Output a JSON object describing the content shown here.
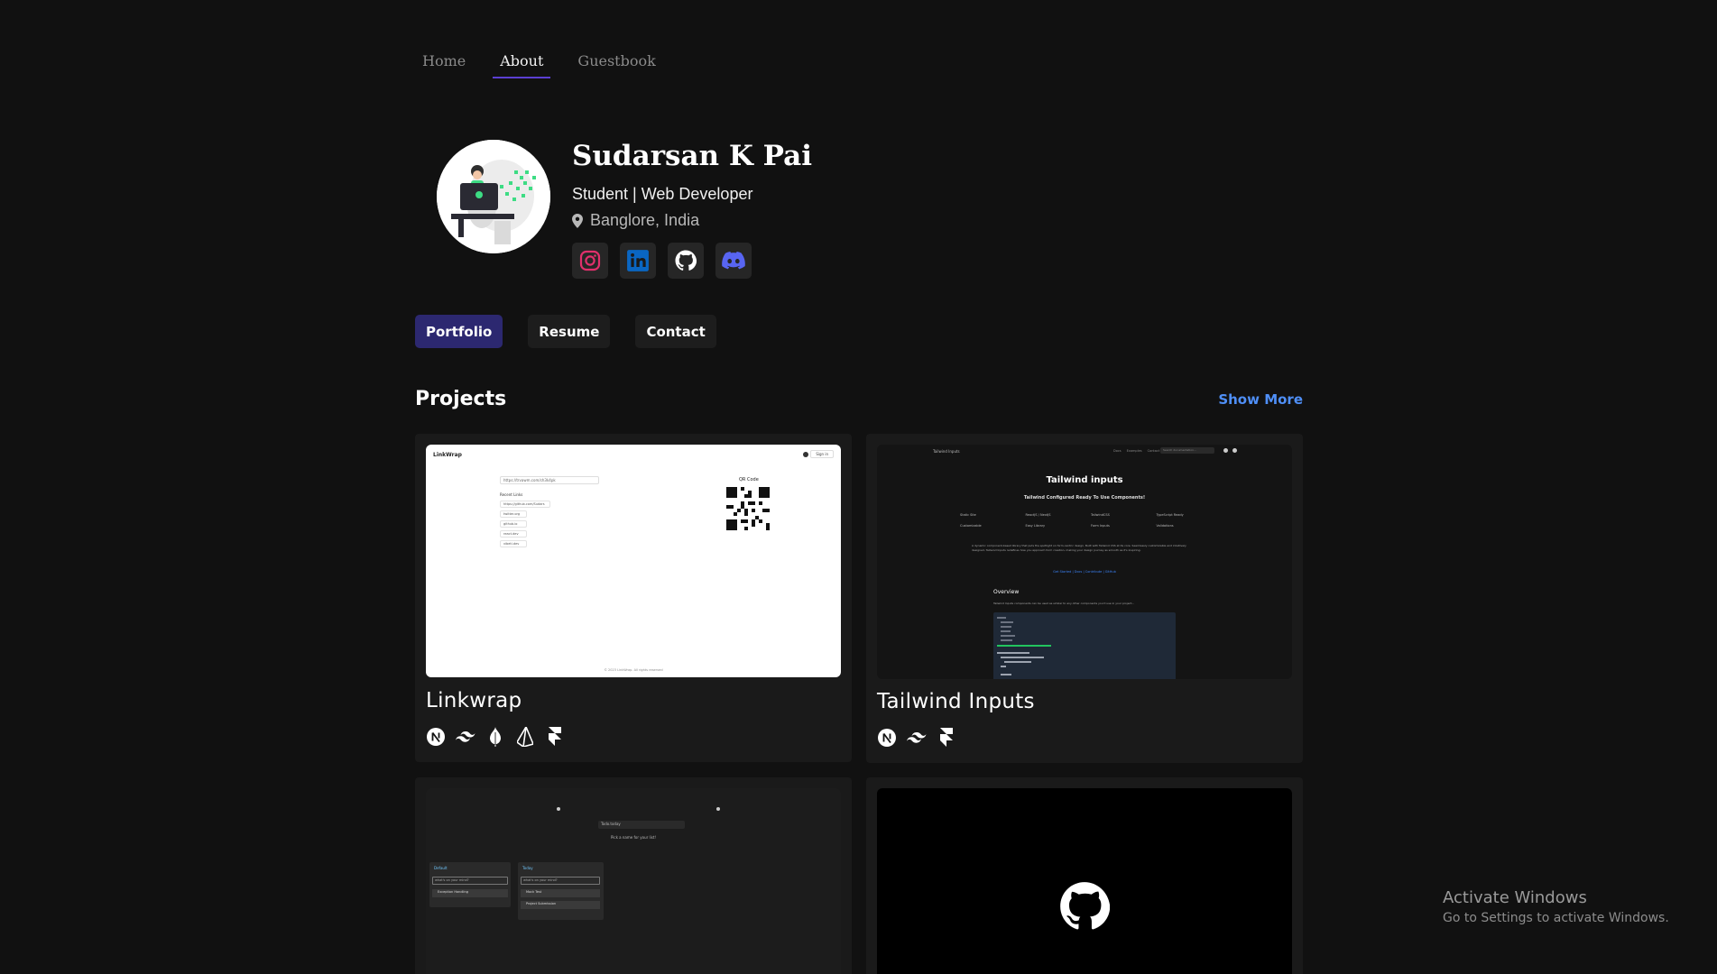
{
  "nav": {
    "items": [
      {
        "label": "Home"
      },
      {
        "label": "About"
      },
      {
        "label": "Guestbook"
      }
    ],
    "active": "About",
    "accent": "#5b3fd3"
  },
  "profile": {
    "name": "Sudarsan K Pai",
    "role": "Student | Web Developer",
    "location": "Banglore, India",
    "socials": [
      {
        "icon": "instagram-icon",
        "color": "#e1306c"
      },
      {
        "icon": "linkedin-icon",
        "color": "#0a66c2"
      },
      {
        "icon": "github-icon",
        "color": "#ffffff"
      },
      {
        "icon": "discord-icon",
        "color": "#5865f2"
      }
    ]
  },
  "tabs": {
    "portfolio": "Portfolio",
    "resume": "Resume",
    "contact": "Contact",
    "active": "Portfolio"
  },
  "projects": {
    "title": "Projects",
    "show_more": "Show More",
    "cards": [
      {
        "title": "Linkwrap",
        "tech": [
          "nextjs-icon",
          "tailwind-icon",
          "mongodb-icon",
          "prisma-icon",
          "framer-icon"
        ],
        "preview": {
          "brand": "LinkWrap",
          "url_value": "https://trvawm.com/ch3k4pk",
          "recent_label": "Recent Links",
          "recent_links": [
            "https://github.com/Sudars",
            "twitter.org",
            "github.io",
            "react.dev",
            "vibeti.dev"
          ],
          "qr_label": "QR Code",
          "footer": "© 2023 LinkWrap. All rights reserved",
          "header_btn": "Sign in"
        }
      },
      {
        "title": "Tailwind Inputs",
        "tech": [
          "nextjs-icon",
          "tailwind-icon",
          "framer-icon"
        ],
        "preview": {
          "brand": "Tailwind Inputs",
          "nav_links": [
            "Docs",
            "Examples",
            "Contact"
          ],
          "search_placeholder": "Search documentation...",
          "heading": "Tailwind inputs",
          "subheading": "Tailwind Configured Ready To Use Components!",
          "features": [
            "Static Site",
            "ReactJS / NextJS",
            "TailwindCSS",
            "TypeScript Ready",
            "Customizable",
            "Easy Library",
            "Form Inputs",
            "Validations"
          ],
          "description": "A dynamic component-based library that puts the spotlight on form-centric design. Built with Tailwind CSS at its core. Seamlessly customizable and intuitively designed, Tailwind Inputs redefines how you approach form creation, making your design journey as smooth as it's inspiring.",
          "links": "Get Started | Docs | Contribute | GitHub",
          "overview_title": "Overview",
          "overview_text": "Tailwind Inputs components can be used as similar to any other components you'd use in your project..."
        }
      },
      {
        "title": "",
        "tech": [],
        "preview": {
          "title_input": "Todo.today",
          "hint": "Pick a name for your list!",
          "lists": [
            {
              "name": "Default",
              "placeholder": "what's on your mind?",
              "items": [
                "Exception Handling"
              ]
            },
            {
              "name": "Today",
              "placeholder": "what's on your mind?",
              "items": [
                "Mock Test",
                "Project Submission"
              ]
            }
          ]
        }
      },
      {
        "title": "",
        "tech": [],
        "preview": {
          "icon": "github-icon"
        }
      }
    ]
  },
  "watermark": {
    "title": "Activate Windows",
    "subtitle": "Go to Settings to activate Windows."
  }
}
